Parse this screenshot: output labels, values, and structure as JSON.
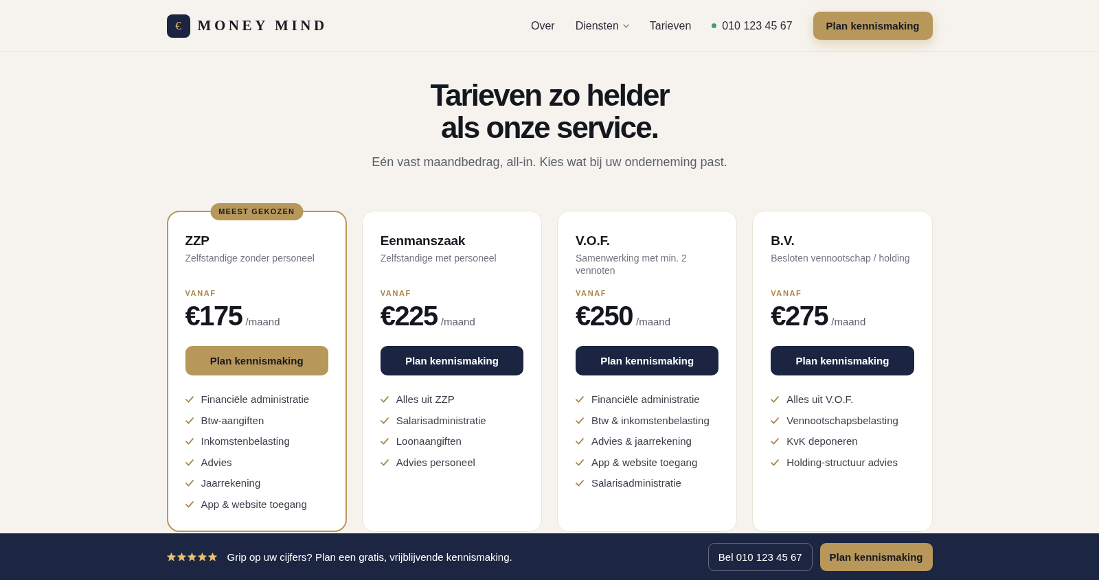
{
  "header": {
    "logo": {
      "mark": "€",
      "name": "MONEY MIND"
    },
    "nav": [
      {
        "label": "Over",
        "kind": "link"
      },
      {
        "label": "Diensten",
        "kind": "dropdown"
      },
      {
        "label": "Tarieven",
        "kind": "link"
      }
    ],
    "phone": "010 123 45 67",
    "cta": "Plan kennismaking"
  },
  "hero": {
    "title": [
      "Tarieven zo helder",
      "als onze service."
    ],
    "subtitle": "Eén vast maandbedrag, all-in. Kies wat bij uw onderneming past."
  },
  "plans": [
    {
      "name": "ZZP",
      "description": "Zelfstandige zonder personeel",
      "featured": true,
      "badge": "MEEST GEKOZEN",
      "price_label": "VANAF",
      "price": "€175",
      "period": "/maand",
      "button": "Plan kennismaking",
      "features": [
        "Financiële administratie",
        "Btw-aangiften",
        "Inkomstenbelasting",
        "Advies",
        "Jaarrekening",
        "App & website toegang"
      ]
    },
    {
      "name": "Eenmanszaak",
      "description": "Zelfstandige met personeel",
      "featured": false,
      "price_label": "VANAF",
      "price": "€225",
      "period": "/maand",
      "button": "Plan kennismaking",
      "features": [
        "Alles uit ZZP",
        "Salarisadministratie",
        "Loonaangiften",
        "Advies personeel"
      ]
    },
    {
      "name": "V.O.F.",
      "description": "Samenwerking met min. 2 vennoten",
      "featured": false,
      "price_label": "VANAF",
      "price": "€250",
      "period": "/maand",
      "button": "Plan kennismaking",
      "features": [
        "Financiële administratie",
        "Btw & inkomstenbelasting",
        "Advies & jaarrekening",
        "App & website toegang",
        "Salarisadministratie"
      ]
    },
    {
      "name": "B.V.",
      "description": "Besloten vennootschap / holding",
      "featured": false,
      "price_label": "VANAF",
      "price": "€275",
      "period": "/maand",
      "button": "Plan kennismaking",
      "features": [
        "Alles uit V.O.F.",
        "Vennootschapsbelasting",
        "KvK deponeren",
        "Holding-structuur advies"
      ]
    }
  ],
  "cta_bar": {
    "stars": 5,
    "text": "Grip op uw cijfers? Plan een gratis, vrijblijvende kennismaking.",
    "call_button": "Bel 010 123 45 67",
    "cta": "Plan kennismaking"
  }
}
